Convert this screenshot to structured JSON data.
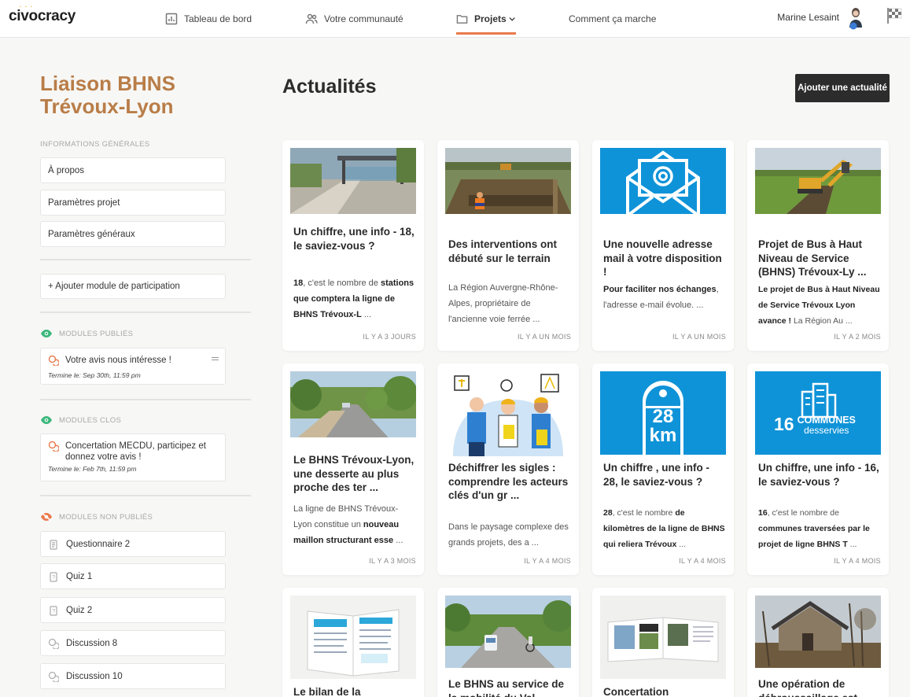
{
  "brand": {
    "name": "civocracy",
    "accent": "#e97a4d",
    "title_color": "#b97d48"
  },
  "nav": {
    "items": [
      {
        "label": "Tableau de bord",
        "icon": "chart-icon"
      },
      {
        "label": "Votre communauté",
        "icon": "people-icon"
      },
      {
        "label": "Projets",
        "icon": "folder-icon"
      },
      {
        "label": "Comment ça marche"
      }
    ],
    "user": "Marine Lesaint"
  },
  "sidebar": {
    "project_title": "Liaison BHNS Trévoux-Lyon",
    "general_label": "INFORMATIONS GÉNÉRALES",
    "general_items": [
      "À propos",
      "Paramètres projet",
      "Paramètres généraux"
    ],
    "add_module": "+ Ajouter module de participation",
    "published_label": "MODULES PUBLIÉS",
    "published": [
      {
        "title": "Votre avis nous intéresse !",
        "date": "Termine le: Sep 30th, 11:59 pm"
      }
    ],
    "closed_label": "MODULES CLOS",
    "closed": [
      {
        "title": "Concertation MECDU, participez et donnez votre avis !",
        "date": "Termine le: Feb 7th, 11:59 pm"
      }
    ],
    "unpublished_label": "MODULES NON PUBLIÉS",
    "unpublished": [
      "Questionnaire 2",
      "Quiz 1",
      "Quiz 2",
      "Discussion 8",
      "Discussion 10"
    ]
  },
  "main": {
    "title": "Actualités",
    "add_button": "Ajouter une actualité",
    "cards": [
      {
        "title": "Un chiffre, une info - 18, le saviez-vous ?",
        "excerpt_html": "<b>18</b>, c'est le nombre de <b>stations que comptera la ligne de BHNS Trévoux-L</b> ...",
        "age": "IL Y A 3 JOURS",
        "image": "bus-station-photo"
      },
      {
        "title": "Des interventions ont débuté sur le terrain",
        "excerpt_html": "La Région Auvergne-Rhône-Alpes, propriétaire de l'ancienne voie ferrée ...",
        "age": "IL Y A UN MOIS",
        "image": "excavation-photo"
      },
      {
        "title": "Une nouvelle adresse mail à votre disposition !",
        "excerpt_html": "<b>Pour faciliter nos échanges</b>, l'adresse e-mail évolue.  ...",
        "age": "IL Y A UN MOIS",
        "image": "email-icon-tile"
      },
      {
        "title": "Projet de Bus à Haut Niveau de Service (BHNS) Trévoux-Ly ...",
        "excerpt_html": "<b>Le projet de Bus à Haut Niveau de Service Trévoux Lyon avance !</b> La Région Au ...",
        "age": "IL Y A 2 MOIS",
        "image": "digger-photo"
      },
      {
        "title": "Le BHNS Trévoux-Lyon, une desserte au plus proche des ter ...",
        "excerpt_html": "La ligne de BHNS Trévoux-Lyon constitue un <b>nouveau maillon structurant esse</b> ...",
        "age": "IL Y A 3 MOIS",
        "image": "road-rendering"
      },
      {
        "title": "Déchiffrer les sigles : comprendre les acteurs clés d'un gr ...",
        "excerpt_html": "Dans le paysage complexe des grands projets, des a ...",
        "age": "IL Y A 4 MOIS",
        "image": "workers-illustration"
      },
      {
        "title": "Un chiffre , une info - 28, le saviez-vous ?",
        "excerpt_html": "<b>28</b>, c'est le nombre <b>de kilomètres de la ligne de BHNS qui reliera Trévoux</b> ...",
        "age": "IL Y A 4 MOIS",
        "image": "milestone-tile",
        "tile_text": [
          "28",
          "km"
        ]
      },
      {
        "title": "Un chiffre, une info - 16, le saviez-vous ?",
        "excerpt_html": "<b>16</b>, c'est le nombre de <b>communes traversées par le projet de ligne BHNS T</b> ...",
        "age": "IL Y A 4 MOIS",
        "image": "communes-tile",
        "tile_text": [
          "16",
          "COMMUNES",
          "desservies"
        ]
      },
      {
        "title": "Le bilan de la",
        "image": "booklet-photo"
      },
      {
        "title": "Le BHNS au service de la mobilité du Val",
        "image": "bus-road-rendering"
      },
      {
        "title": "Concertation",
        "image": "brochure-photo"
      },
      {
        "title": "Une opération de débroussaillage est",
        "image": "old-house-photo"
      }
    ]
  }
}
